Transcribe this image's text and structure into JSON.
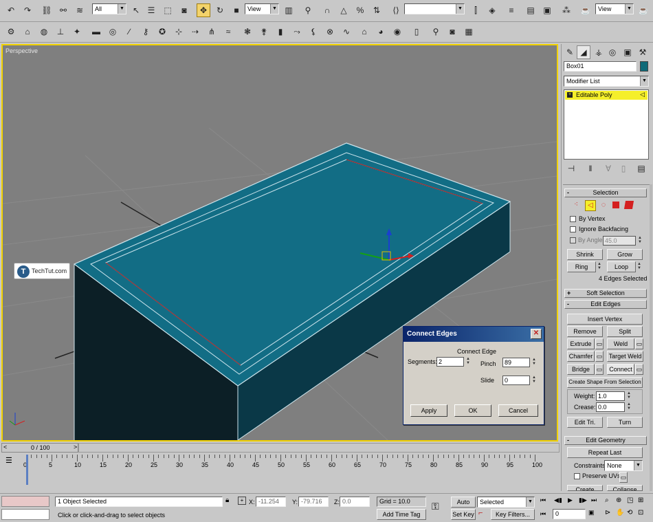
{
  "toolbar1": {
    "selection_filter": "All",
    "ref_coord": "View",
    "named_sel": "",
    "render_view": "View"
  },
  "viewport": {
    "label": "Perspective",
    "watermark": "TechTut.com"
  },
  "command_panel": {
    "object_name": "Box01",
    "object_color": "#0e6a78",
    "modifier_list": "Modifier List",
    "stack_item": "Editable Poly",
    "selection": {
      "title": "Selection",
      "by_vertex": "By Vertex",
      "ignore_backfacing": "Ignore Backfacing",
      "by_angle": "By Angle:",
      "angle_value": "45.0",
      "shrink": "Shrink",
      "grow": "Grow",
      "ring": "Ring",
      "loop": "Loop",
      "status": "4 Edges Selected"
    },
    "soft_selection": "Soft Selection",
    "edit_edges": {
      "title": "Edit Edges",
      "insert_vertex": "Insert Vertex",
      "remove": "Remove",
      "split": "Split",
      "extrude": "Extrude",
      "weld": "Weld",
      "chamfer": "Chamfer",
      "target_weld": "Target Weld",
      "bridge": "Bridge",
      "connect": "Connect",
      "create_shape": "Create Shape From Selection",
      "weight_label": "Weight:",
      "weight_value": "1.0",
      "crease_label": "Crease:",
      "crease_value": "0.0",
      "edit_tri": "Edit Tri.",
      "turn": "Turn"
    },
    "edit_geometry": {
      "title": "Edit Geometry",
      "repeat_last": "Repeat Last",
      "constraints_label": "Constraints:",
      "constraints_value": "None",
      "preserve_uvs": "Preserve UVs",
      "create": "Create",
      "collapse": "Collapse"
    }
  },
  "dialog": {
    "title": "Connect Edges",
    "group_label": "Connect Edge",
    "segments_label": "Segments:",
    "segments_value": "2",
    "pinch_label": "Pinch",
    "pinch_value": "89",
    "slide_label": "Slide",
    "slide_value": "0",
    "apply": "Apply",
    "ok": "OK",
    "cancel": "Cancel"
  },
  "timeline": {
    "frame_indicator": "0 / 100",
    "ticks": [
      "0",
      "5",
      "10",
      "15",
      "20",
      "25",
      "30",
      "35",
      "40",
      "45",
      "50",
      "55",
      "60",
      "65",
      "70",
      "75",
      "80",
      "85",
      "90",
      "95",
      "100"
    ]
  },
  "status": {
    "selection_info": "1 Object Selected",
    "prompt": "Click or click-and-drag to select objects",
    "x_label": "X:",
    "x_value": "-11.254",
    "y_label": "Y:",
    "y_value": "-79.716",
    "z_label": "Z:",
    "z_value": "0.0",
    "grid": "Grid = 10.0",
    "add_time_tag": "Add Time Tag",
    "auto_key": "Auto Key",
    "set_key": "Set Key",
    "key_mode": "Selected",
    "key_filters": "Key Filters...",
    "frame": "0"
  }
}
